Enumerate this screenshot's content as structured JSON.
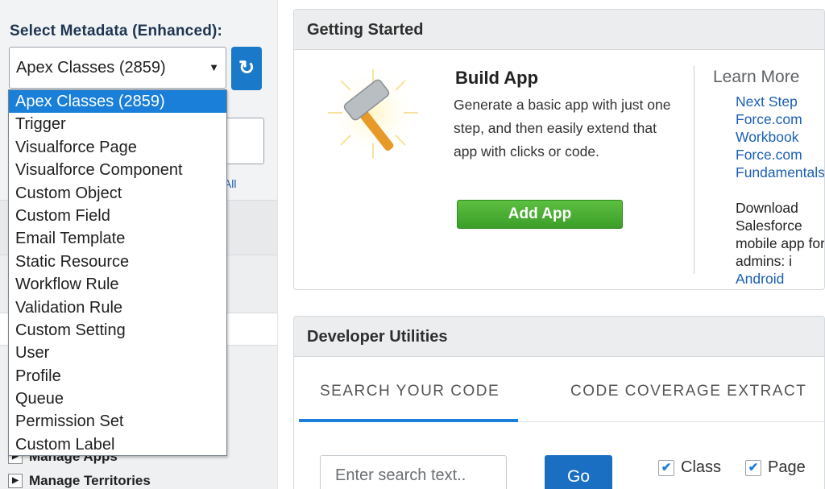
{
  "sidebar": {
    "select_label": "Select Metadata (Enhanced):",
    "selected_value": "Apex Classes (2859)",
    "collapse_text": "se All",
    "tree_items": [
      "Manage Apps",
      "Manage Territories"
    ],
    "dropdown_options": [
      "Apex Classes (2859)",
      "Trigger",
      "Visualforce Page",
      "Visualforce Component",
      "Custom Object",
      "Custom Field",
      "Email Template",
      "Static Resource",
      "Workflow Rule",
      "Validation Rule",
      "Custom Setting",
      "User",
      "Profile",
      "Queue",
      "Permission Set",
      "Custom Label"
    ]
  },
  "getting_started": {
    "title": "Getting Started",
    "build_title": "Build App",
    "build_desc": "Generate a basic app with just one step, and then easily extend that app with clicks or code.",
    "add_app_label": "Add App",
    "learn_more_title": "Learn More",
    "learn_links": [
      "Next Step",
      "Force.com Workbook",
      "Force.com Fundamentals"
    ],
    "download_text": "Download Salesforce mobile app for admins: i",
    "download_tail": "Android"
  },
  "developer_utilities": {
    "title": "Developer Utilities",
    "tabs": [
      "SEARCH YOUR CODE",
      "CODE COVERAGE EXTRACT"
    ],
    "search_placeholder": "Enter search text..",
    "go_label": "Go",
    "checkboxes": [
      {
        "label": "Class",
        "checked": true
      },
      {
        "label": "Page",
        "checked": true
      }
    ]
  },
  "colors": {
    "accent": "#1a7fd9",
    "add_app_green": "#4caf34",
    "link": "#1a5fb4"
  }
}
